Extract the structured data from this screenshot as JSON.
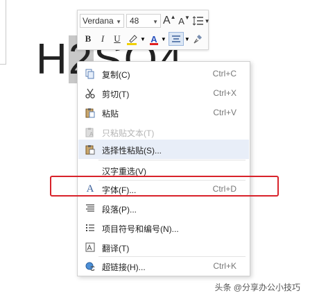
{
  "document": {
    "text_before": "H",
    "text_selected": "2",
    "text_after": "SO4"
  },
  "mini_toolbar": {
    "font_name": "Verdana",
    "font_size": "48",
    "grow_font_label": "A",
    "shrink_font_label": "A",
    "bold_label": "B",
    "italic_label": "I",
    "underline_label": "U",
    "font_color_label": "A",
    "colors": {
      "font_color": "#e02020",
      "highlight": "#f0d000"
    }
  },
  "context_menu": {
    "items": [
      {
        "label": "复制(C)",
        "shortcut": "Ctrl+C",
        "icon": "copy-icon"
      },
      {
        "label": "剪切(T)",
        "shortcut": "Ctrl+X",
        "icon": "cut-icon"
      },
      {
        "label": "粘贴",
        "shortcut": "Ctrl+V",
        "icon": "paste-icon"
      },
      {
        "label": "只粘贴文本(T)",
        "shortcut": "",
        "icon": "paste-text-icon"
      },
      {
        "label": "选择性粘贴(S)...",
        "shortcut": "",
        "icon": "paste-special-icon"
      },
      {
        "label": "汉字重选(V)",
        "shortcut": "",
        "icon": ""
      },
      {
        "label": "字体(F)...",
        "shortcut": "Ctrl+D",
        "icon": "font-icon"
      },
      {
        "label": "段落(P)...",
        "shortcut": "",
        "icon": "paragraph-icon"
      },
      {
        "label": "项目符号和编号(N)...",
        "shortcut": "",
        "icon": "bullets-icon"
      },
      {
        "label": "翻译(T)",
        "shortcut": "",
        "icon": "translate-icon"
      },
      {
        "label": "超链接(H)...",
        "shortcut": "Ctrl+K",
        "icon": "hyperlink-icon"
      }
    ]
  },
  "watermark": "头条 @分享办公小技巧"
}
